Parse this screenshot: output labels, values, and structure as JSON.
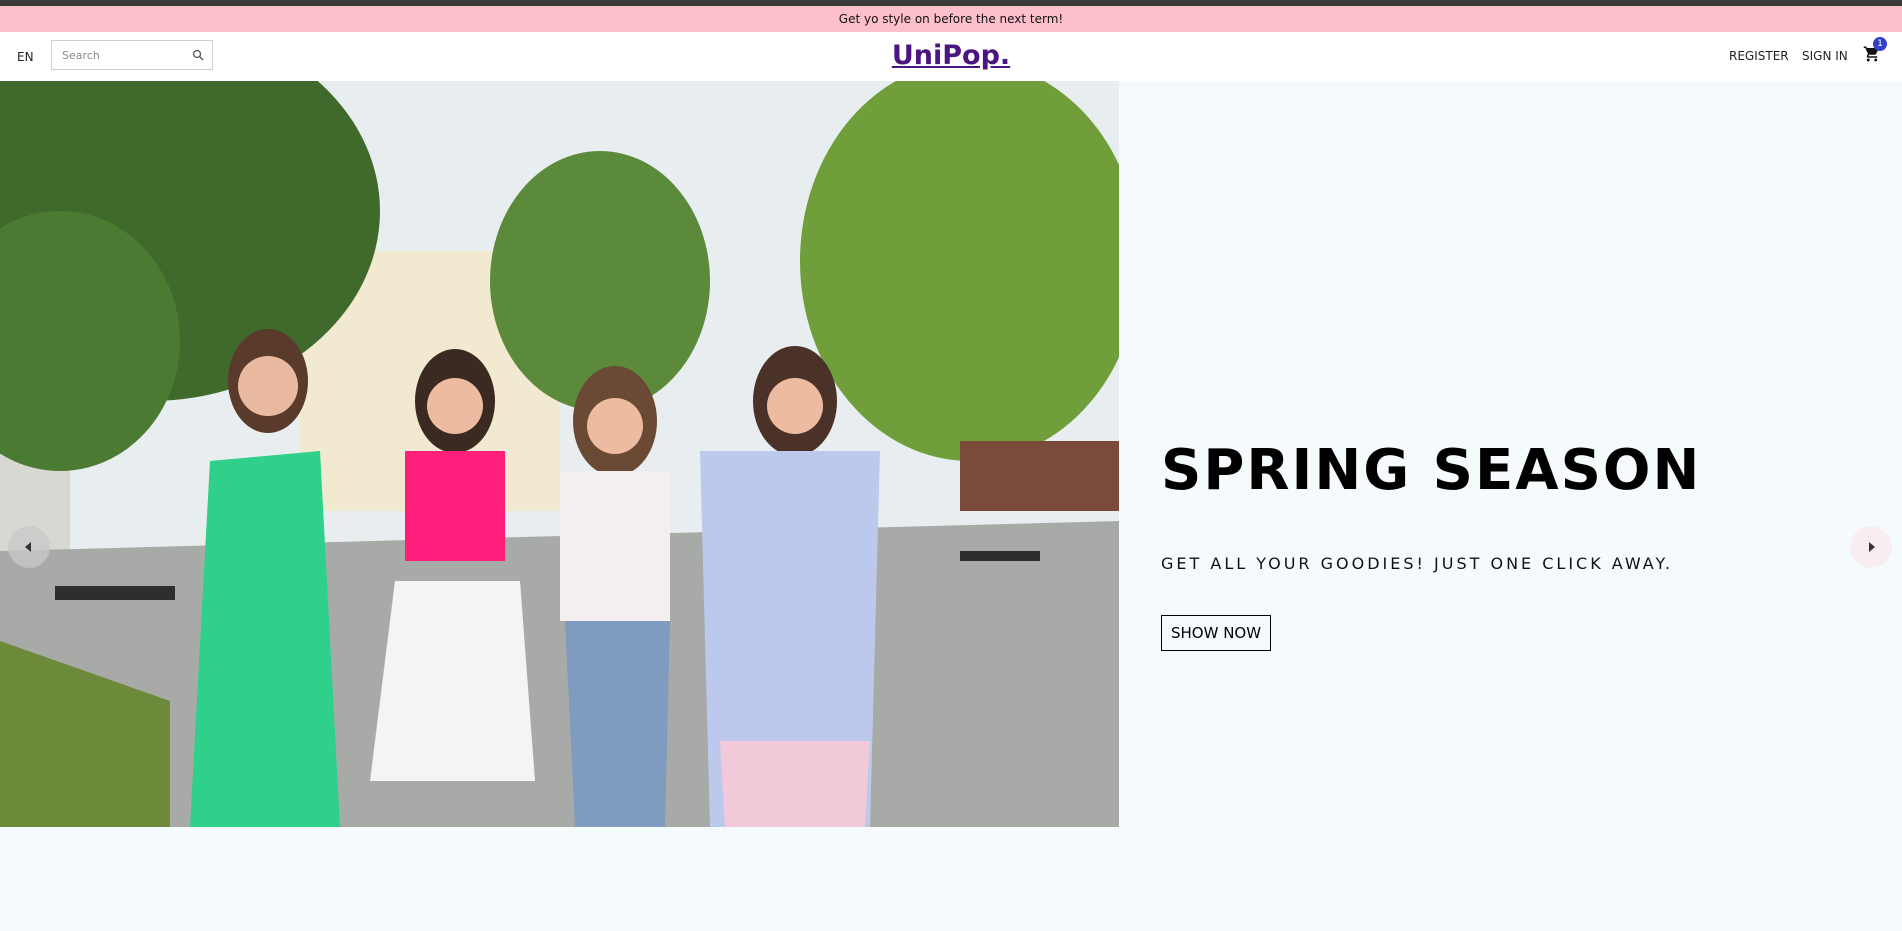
{
  "announcement": {
    "text": "Get yo style on before the next term!"
  },
  "navbar": {
    "language": "EN",
    "search": {
      "placeholder": "Search",
      "value": ""
    },
    "logo": "UniPop.",
    "register": "REGISTER",
    "sign_in": "SIGN IN",
    "cart_count": "1"
  },
  "hero": {
    "title": "SPRING SEASON",
    "description": "GET ALL YOUR GOODIES! JUST ONE CLICK AWAY.",
    "cta": "SHOW NOW"
  },
  "colors": {
    "announcement_bg": "#fdc0cb",
    "logo": "#4a1580",
    "badge": "#3540c8",
    "page_bg": "#f5fafd"
  },
  "icons": {
    "search": "search-icon",
    "cart": "cart-icon",
    "prev": "arrow-left-icon",
    "next": "arrow-right-icon"
  }
}
